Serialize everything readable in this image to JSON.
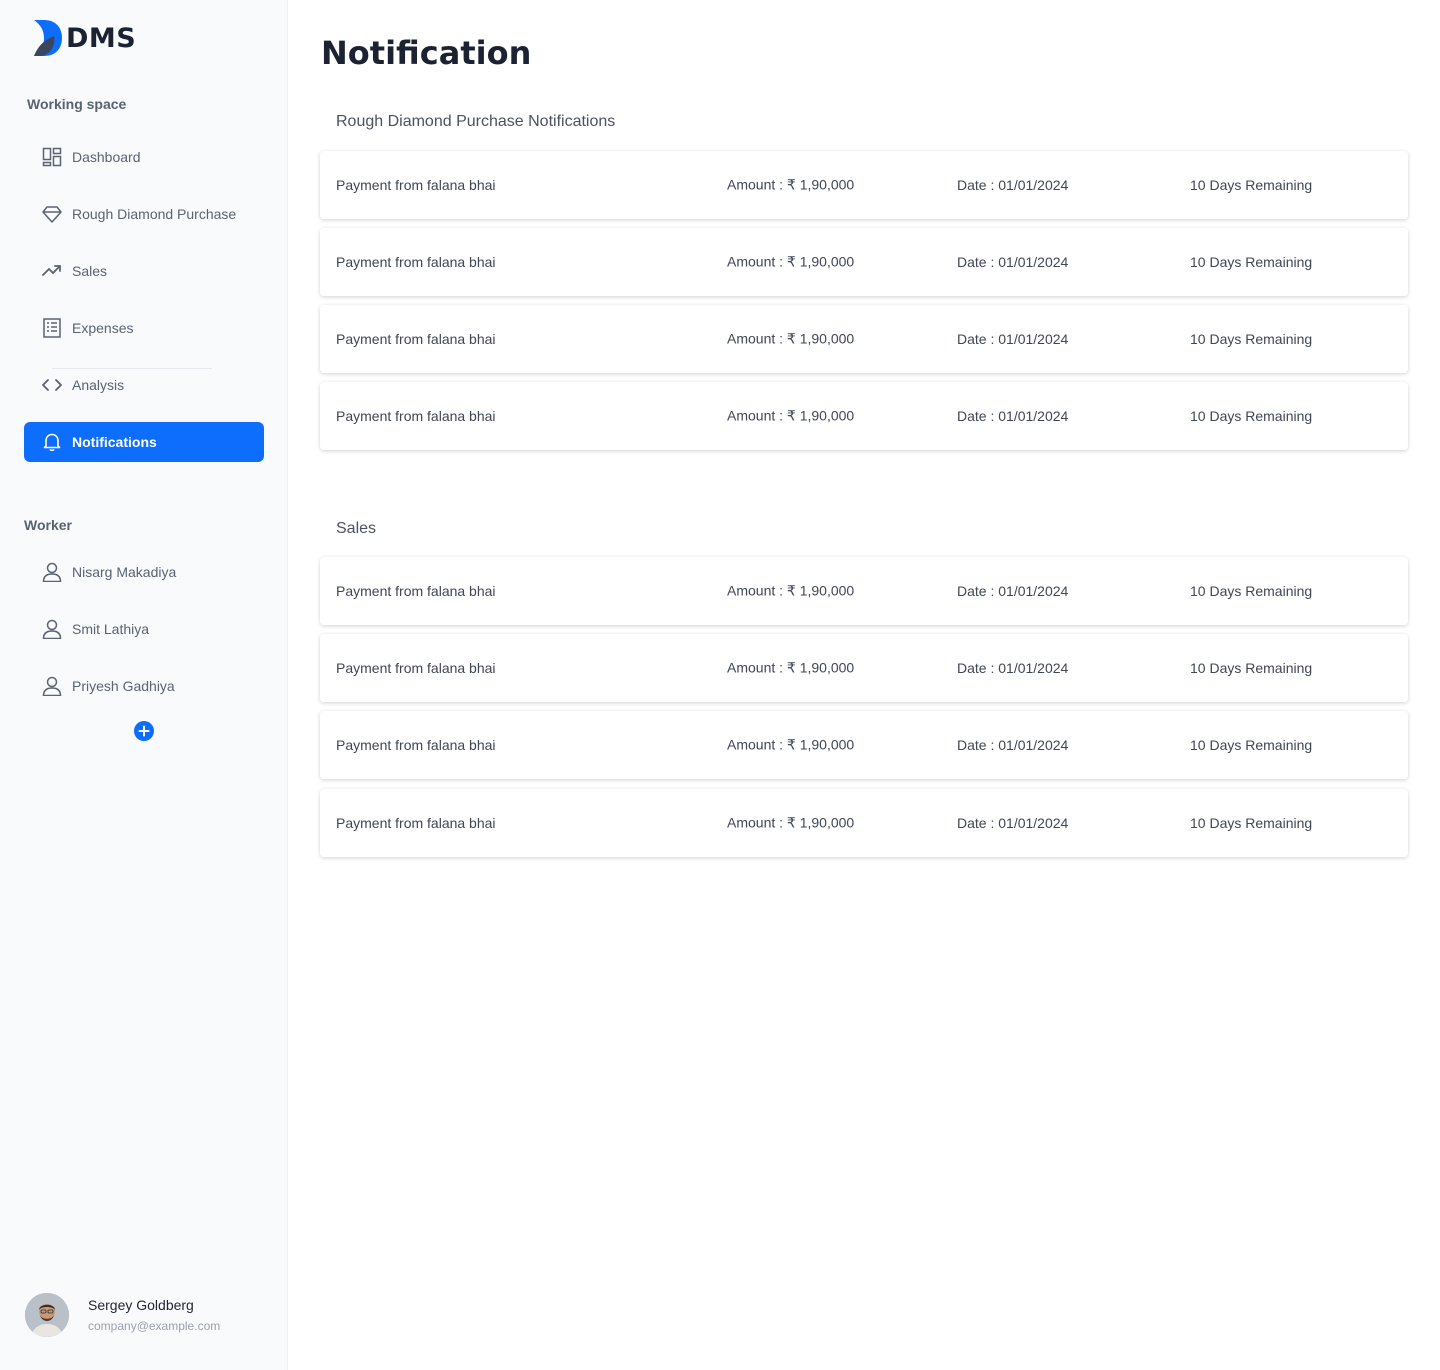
{
  "app": {
    "logo_text": "DMS"
  },
  "sidebar": {
    "working_space_label": "Working space",
    "items": [
      {
        "label": "Dashboard",
        "icon": "dashboard-icon"
      },
      {
        "label": "Rough Diamond Purchase",
        "icon": "diamond-icon"
      },
      {
        "label": "Sales",
        "icon": "trend-up-icon"
      },
      {
        "label": "Expenses",
        "icon": "receipt-icon"
      },
      {
        "label": "Analysis",
        "icon": "code-icon"
      },
      {
        "label": "Notifications",
        "icon": "bell-icon",
        "active": true
      }
    ],
    "worker_label": "Worker",
    "workers": [
      {
        "name": "Nisarg Makadiya",
        "icon": "user-icon"
      },
      {
        "name": "Smit Lathiya",
        "icon": "user-icon"
      },
      {
        "name": "Priyesh Gadhiya",
        "icon": "user-icon"
      }
    ],
    "add_worker_icon": "plus-circle-icon",
    "profile": {
      "name": "Sergey Goldberg",
      "email": "company@example.com"
    },
    "colors": {
      "accent": "#0d6efd",
      "background": "#f9fafb"
    }
  },
  "main": {
    "title": "Notification",
    "groups": [
      {
        "title": "Rough Diamond Purchase Notifications",
        "rows": [
          {
            "description": "Payment from falana bhai",
            "amount": "Amount : ₹ 1,90,000",
            "date": "Date : 01/01/2024",
            "remaining": "10 Days Remaining"
          },
          {
            "description": "Payment from falana bhai",
            "amount": "Amount : ₹ 1,90,000",
            "date": "Date : 01/01/2024",
            "remaining": "10 Days Remaining"
          },
          {
            "description": "Payment from falana bhai",
            "amount": "Amount : ₹ 1,90,000",
            "date": "Date : 01/01/2024",
            "remaining": "10 Days Remaining"
          },
          {
            "description": "Payment from falana bhai",
            "amount": "Amount : ₹ 1,90,000",
            "date": "Date : 01/01/2024",
            "remaining": "10 Days Remaining"
          }
        ]
      },
      {
        "title": "Sales",
        "rows": [
          {
            "description": "Payment from falana bhai",
            "amount": "Amount : ₹ 1,90,000",
            "date": "Date : 01/01/2024",
            "remaining": "10 Days Remaining"
          },
          {
            "description": "Payment from falana bhai",
            "amount": "Amount : ₹ 1,90,000",
            "date": "Date : 01/01/2024",
            "remaining": "10 Days Remaining"
          },
          {
            "description": "Payment from falana bhai",
            "amount": "Amount : ₹ 1,90,000",
            "date": "Date : 01/01/2024",
            "remaining": "10 Days Remaining"
          },
          {
            "description": "Payment from falana bhai",
            "amount": "Amount : ₹ 1,90,000",
            "date": "Date : 01/01/2024",
            "remaining": "10 Days Remaining"
          }
        ]
      }
    ]
  }
}
